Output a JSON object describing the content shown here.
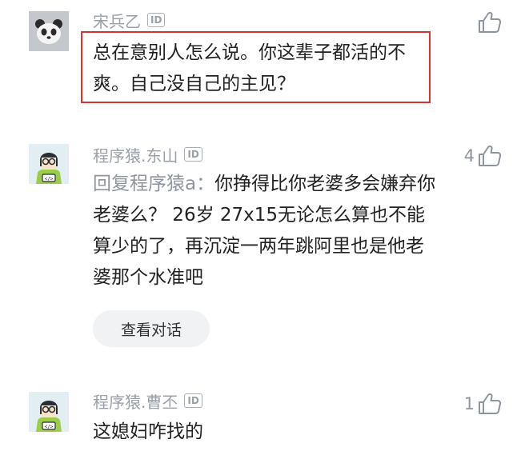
{
  "comments": [
    {
      "author": "宋兵乙",
      "id_badge": "ID",
      "text": "总在意别人怎么说。你这辈子都活的不爽。自己没自己的主见？",
      "like_count": ""
    },
    {
      "author": "程序猿.东山",
      "id_badge": "ID",
      "reply_prefix": "回复程序猿a：",
      "text": "你挣得比你老婆多会嫌弃你老婆么？ 26岁 27x15无论怎么算也不能算少的了，再沉淀一两年跳阿里也是他老婆那个水准吧",
      "like_count": "4",
      "view_dialog_label": "查看对话"
    },
    {
      "author": "程序猿.曹丕",
      "id_badge": "ID",
      "text": "这媳妇咋找的",
      "like_count": "1"
    }
  ],
  "colors": {
    "highlight_border": "#e03131",
    "muted_text": "#9aa0a8",
    "body_text": "#222222"
  },
  "icons": {
    "like": "thumbs-up-icon",
    "avatar_1": "panda-avatar",
    "avatar_2": "programmer-avatar",
    "avatar_3": "programmer-avatar"
  }
}
